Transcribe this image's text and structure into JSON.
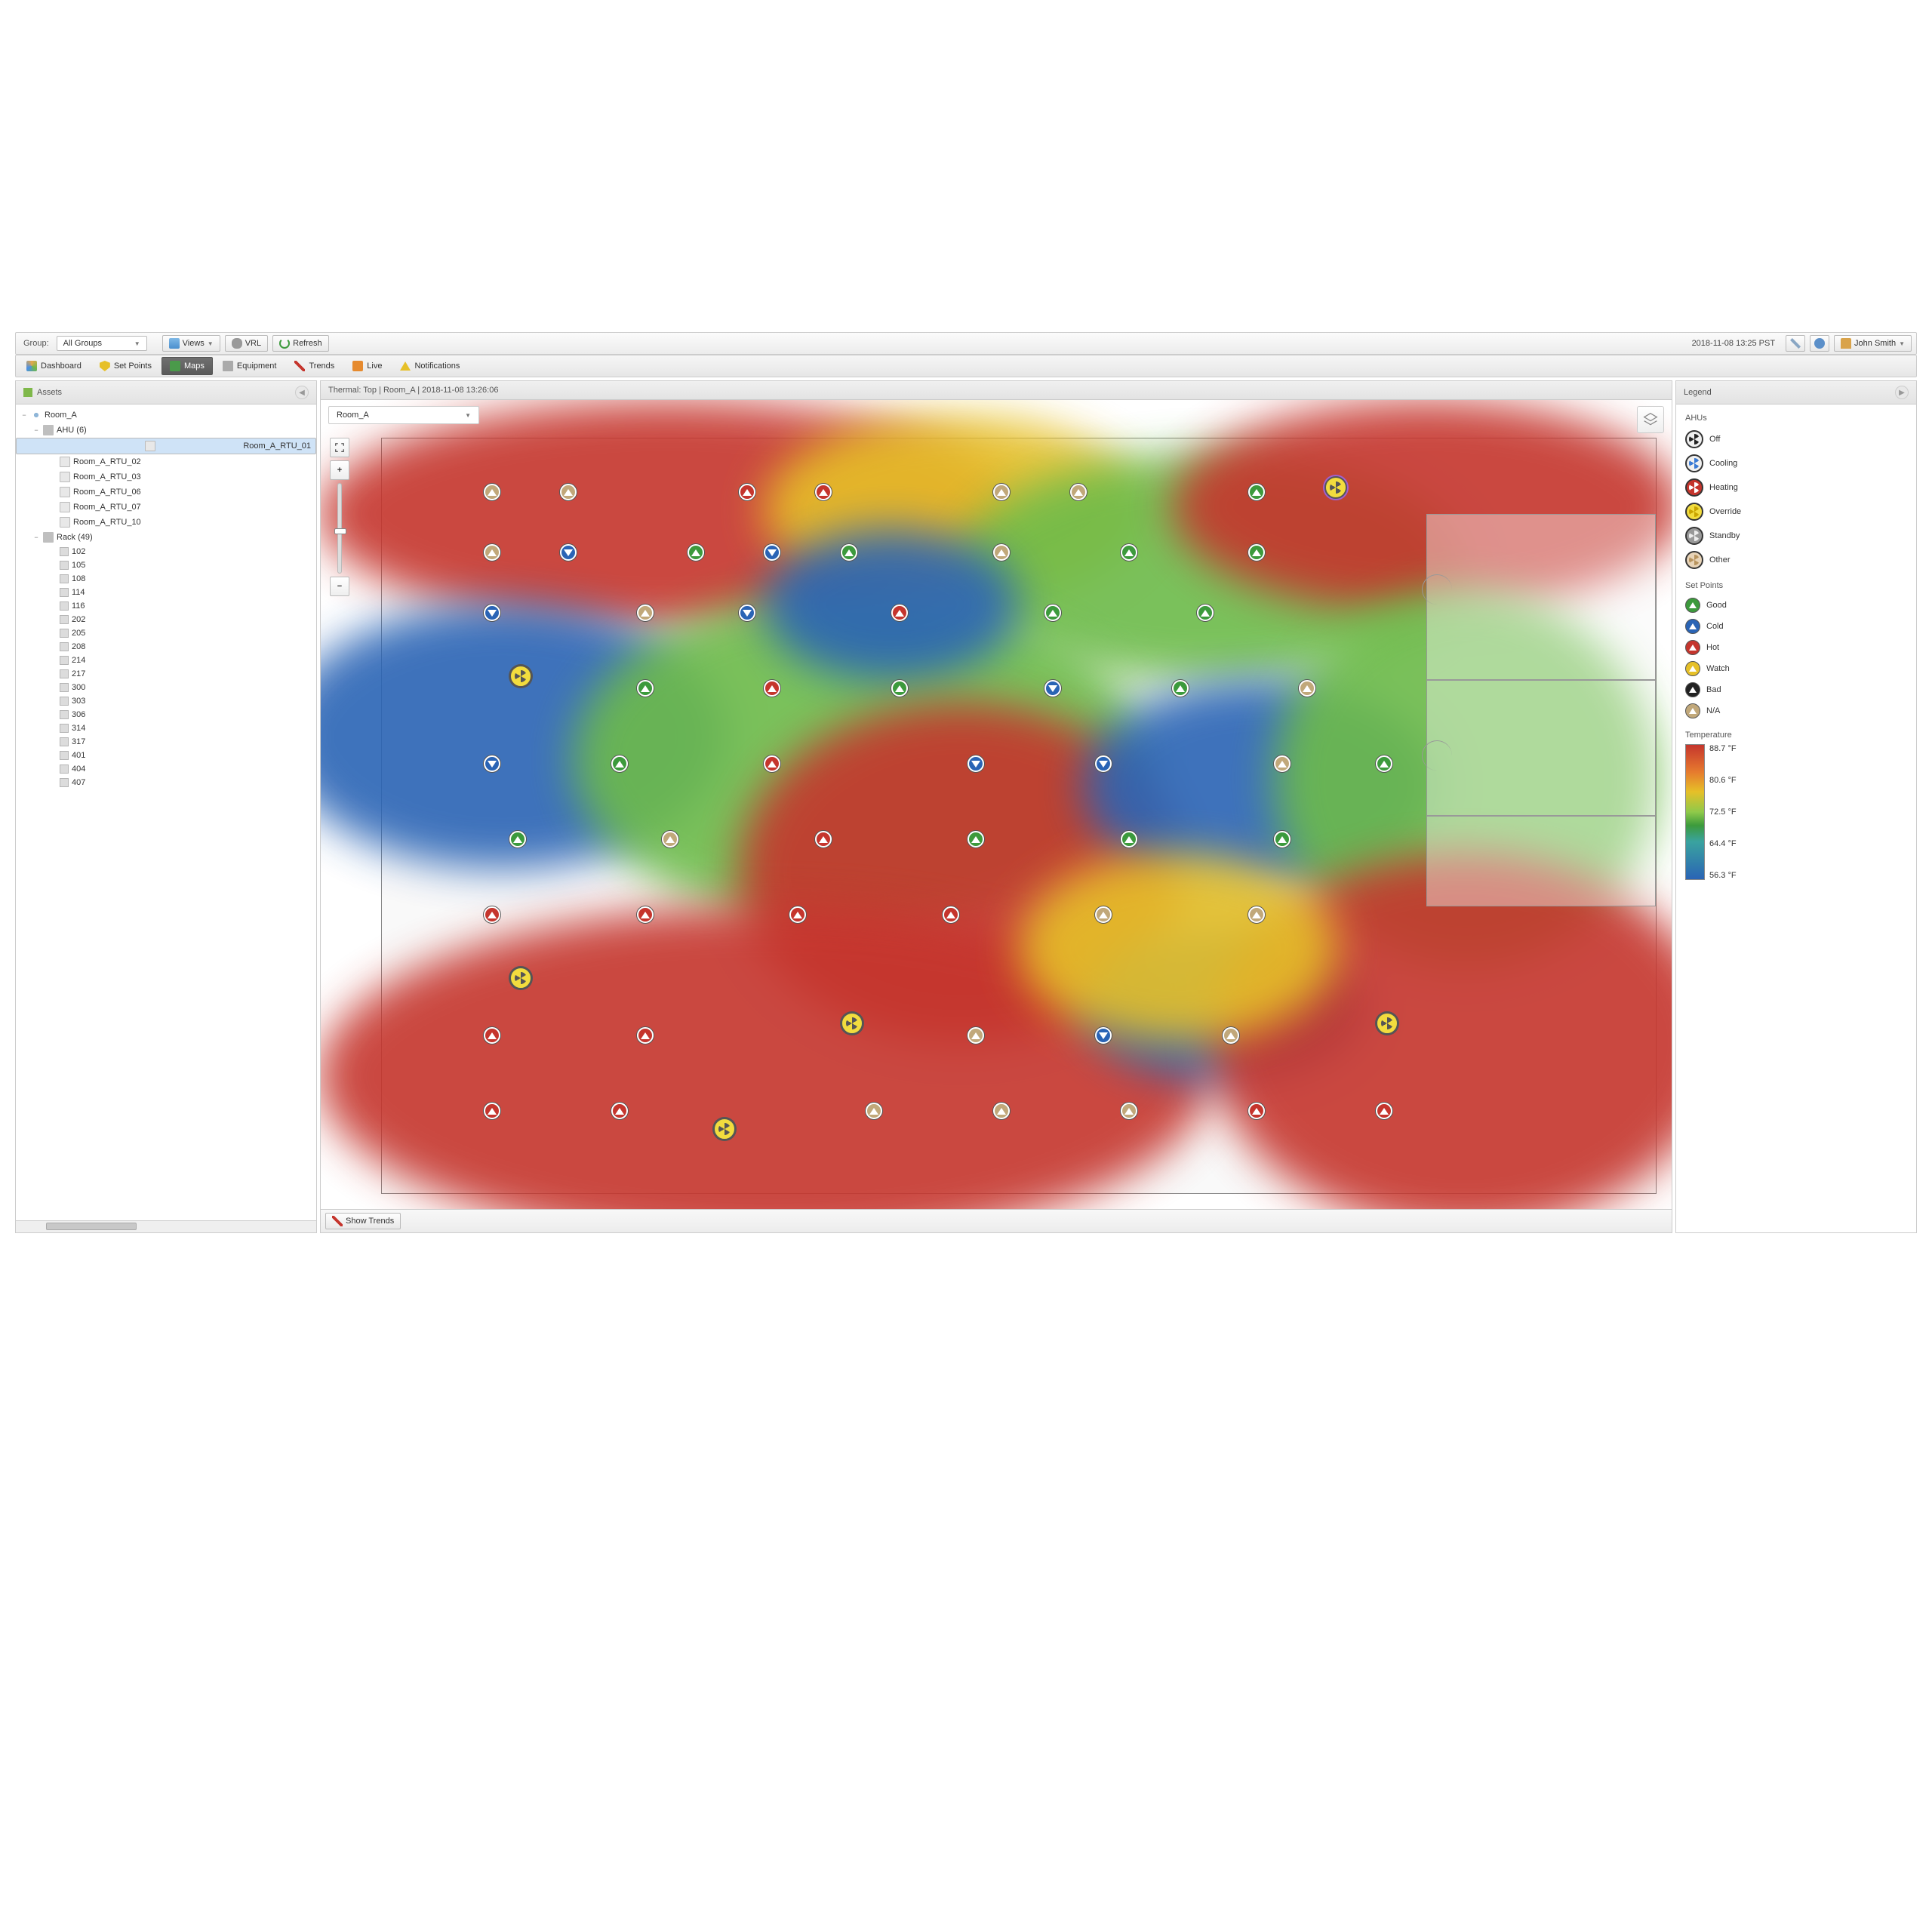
{
  "toolbar": {
    "group_label": "Group:",
    "group_value": "All Groups",
    "views": "Views",
    "vrl": "VRL",
    "refresh": "Refresh",
    "timestamp": "2018-11-08 13:25 PST",
    "user": "John Smith"
  },
  "tabs": [
    {
      "label": "Dashboard",
      "name": "tab-dashboard"
    },
    {
      "label": "Set Points",
      "name": "tab-setpoints"
    },
    {
      "label": "Maps",
      "name": "tab-maps",
      "active": true
    },
    {
      "label": "Equipment",
      "name": "tab-equipment"
    },
    {
      "label": "Trends",
      "name": "tab-trends"
    },
    {
      "label": "Live",
      "name": "tab-live"
    },
    {
      "label": "Notifications",
      "name": "tab-notifications"
    }
  ],
  "assets": {
    "title": "Assets",
    "tree": {
      "room": "Room_A",
      "ahu_label": "AHU (6)",
      "ahu_items": [
        "Room_A_RTU_01",
        "Room_A_RTU_02",
        "Room_A_RTU_03",
        "Room_A_RTU_06",
        "Room_A_RTU_07",
        "Room_A_RTU_10"
      ],
      "selected_ahu": "Room_A_RTU_01",
      "rack_label": "Rack (49)",
      "rack_items": [
        "102",
        "105",
        "108",
        "114",
        "116",
        "202",
        "205",
        "208",
        "214",
        "217",
        "300",
        "303",
        "306",
        "314",
        "317",
        "401",
        "404",
        "407"
      ]
    }
  },
  "map": {
    "header": "Thermal: Top | Room_A | 2018-11-08 13:26:06",
    "room_selector": "Room_A",
    "show_trends": "Show Trends"
  },
  "legend": {
    "title": "Legend",
    "ahus_title": "AHUs",
    "ahus": [
      "Off",
      "Cooling",
      "Heating",
      "Override",
      "Standby",
      "Other"
    ],
    "sp_title": "Set Points",
    "sp": [
      "Good",
      "Cold",
      "Hot",
      "Watch",
      "Bad",
      "N/A"
    ],
    "temp_title": "Temperature",
    "temps": [
      "88.7 °F",
      "80.6 °F",
      "72.5 °F",
      "64.4 °F",
      "56.3 °F"
    ]
  },
  "chart_data": {
    "type": "heatmap",
    "title": "Thermal: Top | Room_A",
    "colorscale_label": "Temperature",
    "colorscale_range": [
      56.3,
      88.7
    ],
    "colorscale_unit": "°F",
    "colorscale_ticks": [
      88.7,
      80.6,
      72.5,
      64.4,
      56.3
    ],
    "note": "irregular spatial heatmap over floorplan; values are approximate regional temps",
    "regions": [
      {
        "area": "top-left",
        "approx_temp": 86
      },
      {
        "area": "top-center",
        "approx_temp": 72
      },
      {
        "area": "top-right",
        "approx_temp": 80
      },
      {
        "area": "mid-left",
        "approx_temp": 60
      },
      {
        "area": "mid-center",
        "approx_temp": 86
      },
      {
        "area": "mid-right",
        "approx_temp": 60
      },
      {
        "area": "bottom-left",
        "approx_temp": 87
      },
      {
        "area": "bottom-center",
        "approx_temp": 86
      },
      {
        "area": "bottom-right",
        "approx_temp": 84
      }
    ],
    "marker_legend": {
      "ahu_states": [
        "Off",
        "Cooling",
        "Heating",
        "Override",
        "Standby",
        "Other"
      ],
      "setpoint_states": [
        "Good",
        "Cold",
        "Hot",
        "Watch",
        "Bad",
        "N/A"
      ]
    }
  }
}
